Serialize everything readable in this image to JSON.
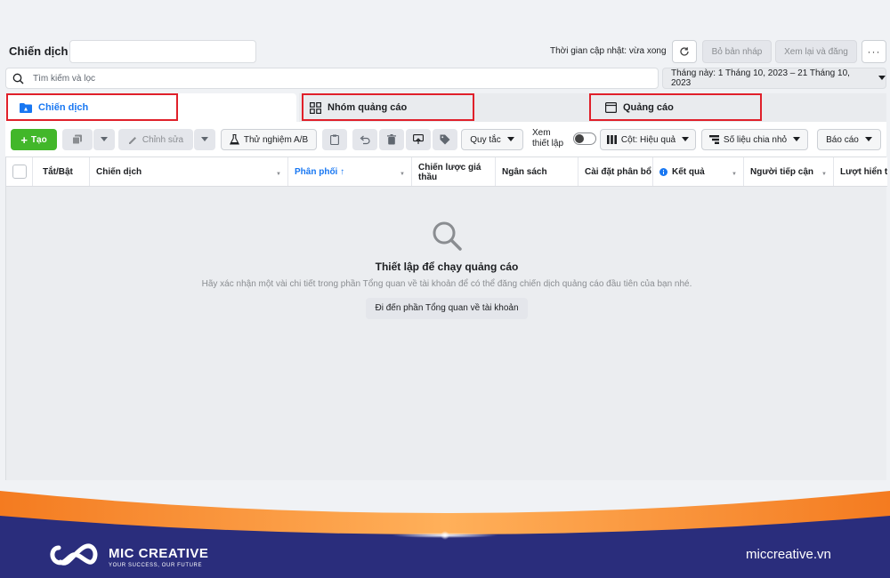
{
  "header": {
    "title": "Chiến dịch",
    "update_status": "Thời gian cập nhật: vừa xong",
    "draft_label": "Bỏ bản nháp",
    "review_label": "Xem lại và đăng",
    "more_label": "···"
  },
  "search": {
    "placeholder": "Tìm kiếm và lọc",
    "date_range": "Tháng này: 1 Tháng 10, 2023 – 21 Tháng 10, 2023"
  },
  "tabs": [
    {
      "label": "Chiến dịch",
      "icon": "campaign-folder-icon"
    },
    {
      "label": "Nhóm quảng cáo",
      "icon": "grid-icon"
    },
    {
      "label": "Quảng cáo",
      "icon": "ad-window-icon"
    }
  ],
  "toolbar": {
    "create_label": "Tạo",
    "edit_label": "Chỉnh sửa",
    "ab_test_label": "Thử nghiệm A/B",
    "rules_label": "Quy tắc",
    "view_setup_label_1": "Xem",
    "view_setup_label_2": "thiết lập",
    "columns_label": "Cột: Hiệu quả",
    "breakdown_label": "Số liệu chia nhỏ",
    "reports_label": "Báo cáo"
  },
  "table": {
    "columns": [
      "Tắt/Bật",
      "Chiến dịch",
      "Phân phối ↑",
      "Chiến lược giá thầu",
      "Ngân sách",
      "Cài đặt phân bổ",
      "Kết quả",
      "Người tiếp cận",
      "Lượt hiển thị"
    ]
  },
  "empty_state": {
    "title": "Thiết lập để chạy quảng cáo",
    "description": "Hãy xác nhận một vài chi tiết trong phần Tổng quan về tài khoản để có thể đăng chiến dịch quảng cáo đầu tiên của bạn nhé.",
    "button_label": "Đi đến phần Tổng quan về tài khoản"
  },
  "branding": {
    "name": "MIC CREATIVE",
    "tagline": "YOUR SUCCESS, OUR FUTURE",
    "website": "miccreative.vn"
  },
  "colors": {
    "accent": "#1877f2",
    "create": "#42b72a",
    "highlight": "#e0202a",
    "footer_navy": "#2a2d7c",
    "footer_orange": "#f47b20"
  }
}
